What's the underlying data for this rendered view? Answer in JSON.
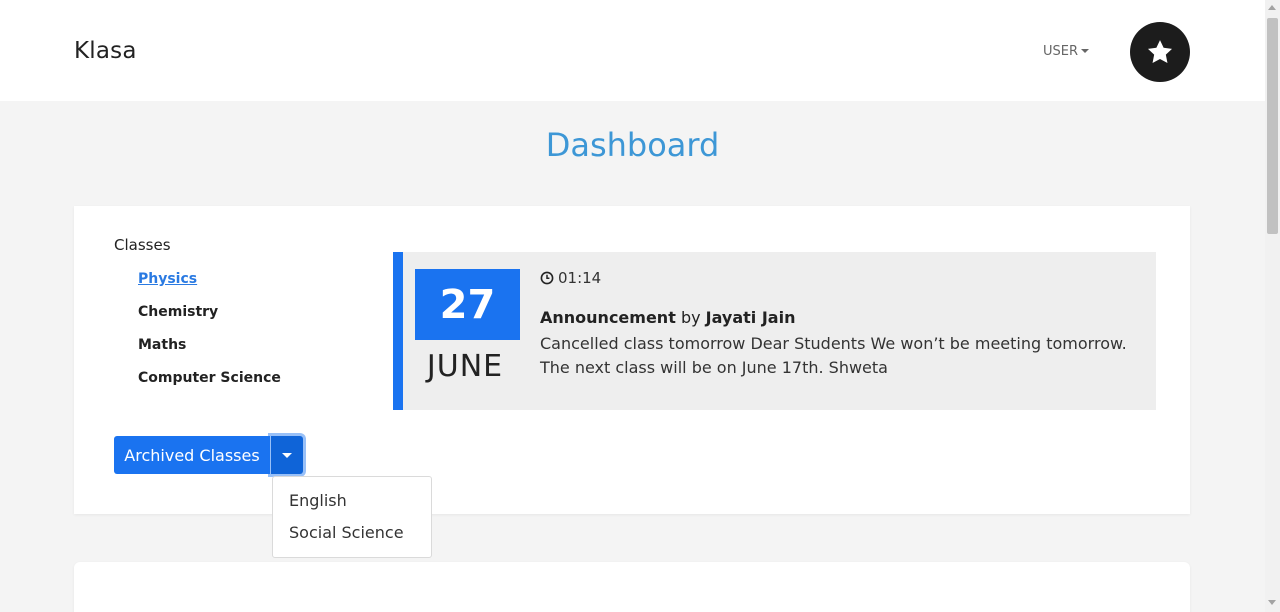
{
  "app": {
    "brand": "Klasa"
  },
  "header": {
    "user_menu_label": "USER",
    "avatar_icon": "star-icon"
  },
  "page": {
    "title": "Dashboard"
  },
  "classes": {
    "heading": "Classes",
    "items": [
      {
        "label": "Physics",
        "active": true
      },
      {
        "label": "Chemistry",
        "active": false
      },
      {
        "label": "Maths",
        "active": false
      },
      {
        "label": "Computer Science",
        "active": false
      }
    ]
  },
  "announcement": {
    "day": "27",
    "month": "JUNE",
    "time": "01:14",
    "type": "Announcement",
    "by_word": "by",
    "author": "Jayati Jain",
    "body": "Cancelled class tomorrow Dear Students We won’t be meeting tomorrow. The next class will be on June 17th. Shweta"
  },
  "archived": {
    "button_label": "Archived Classes",
    "items": [
      "English",
      "Social Science"
    ]
  },
  "colors": {
    "accent": "#1a73f0",
    "title": "#3d97d6"
  }
}
